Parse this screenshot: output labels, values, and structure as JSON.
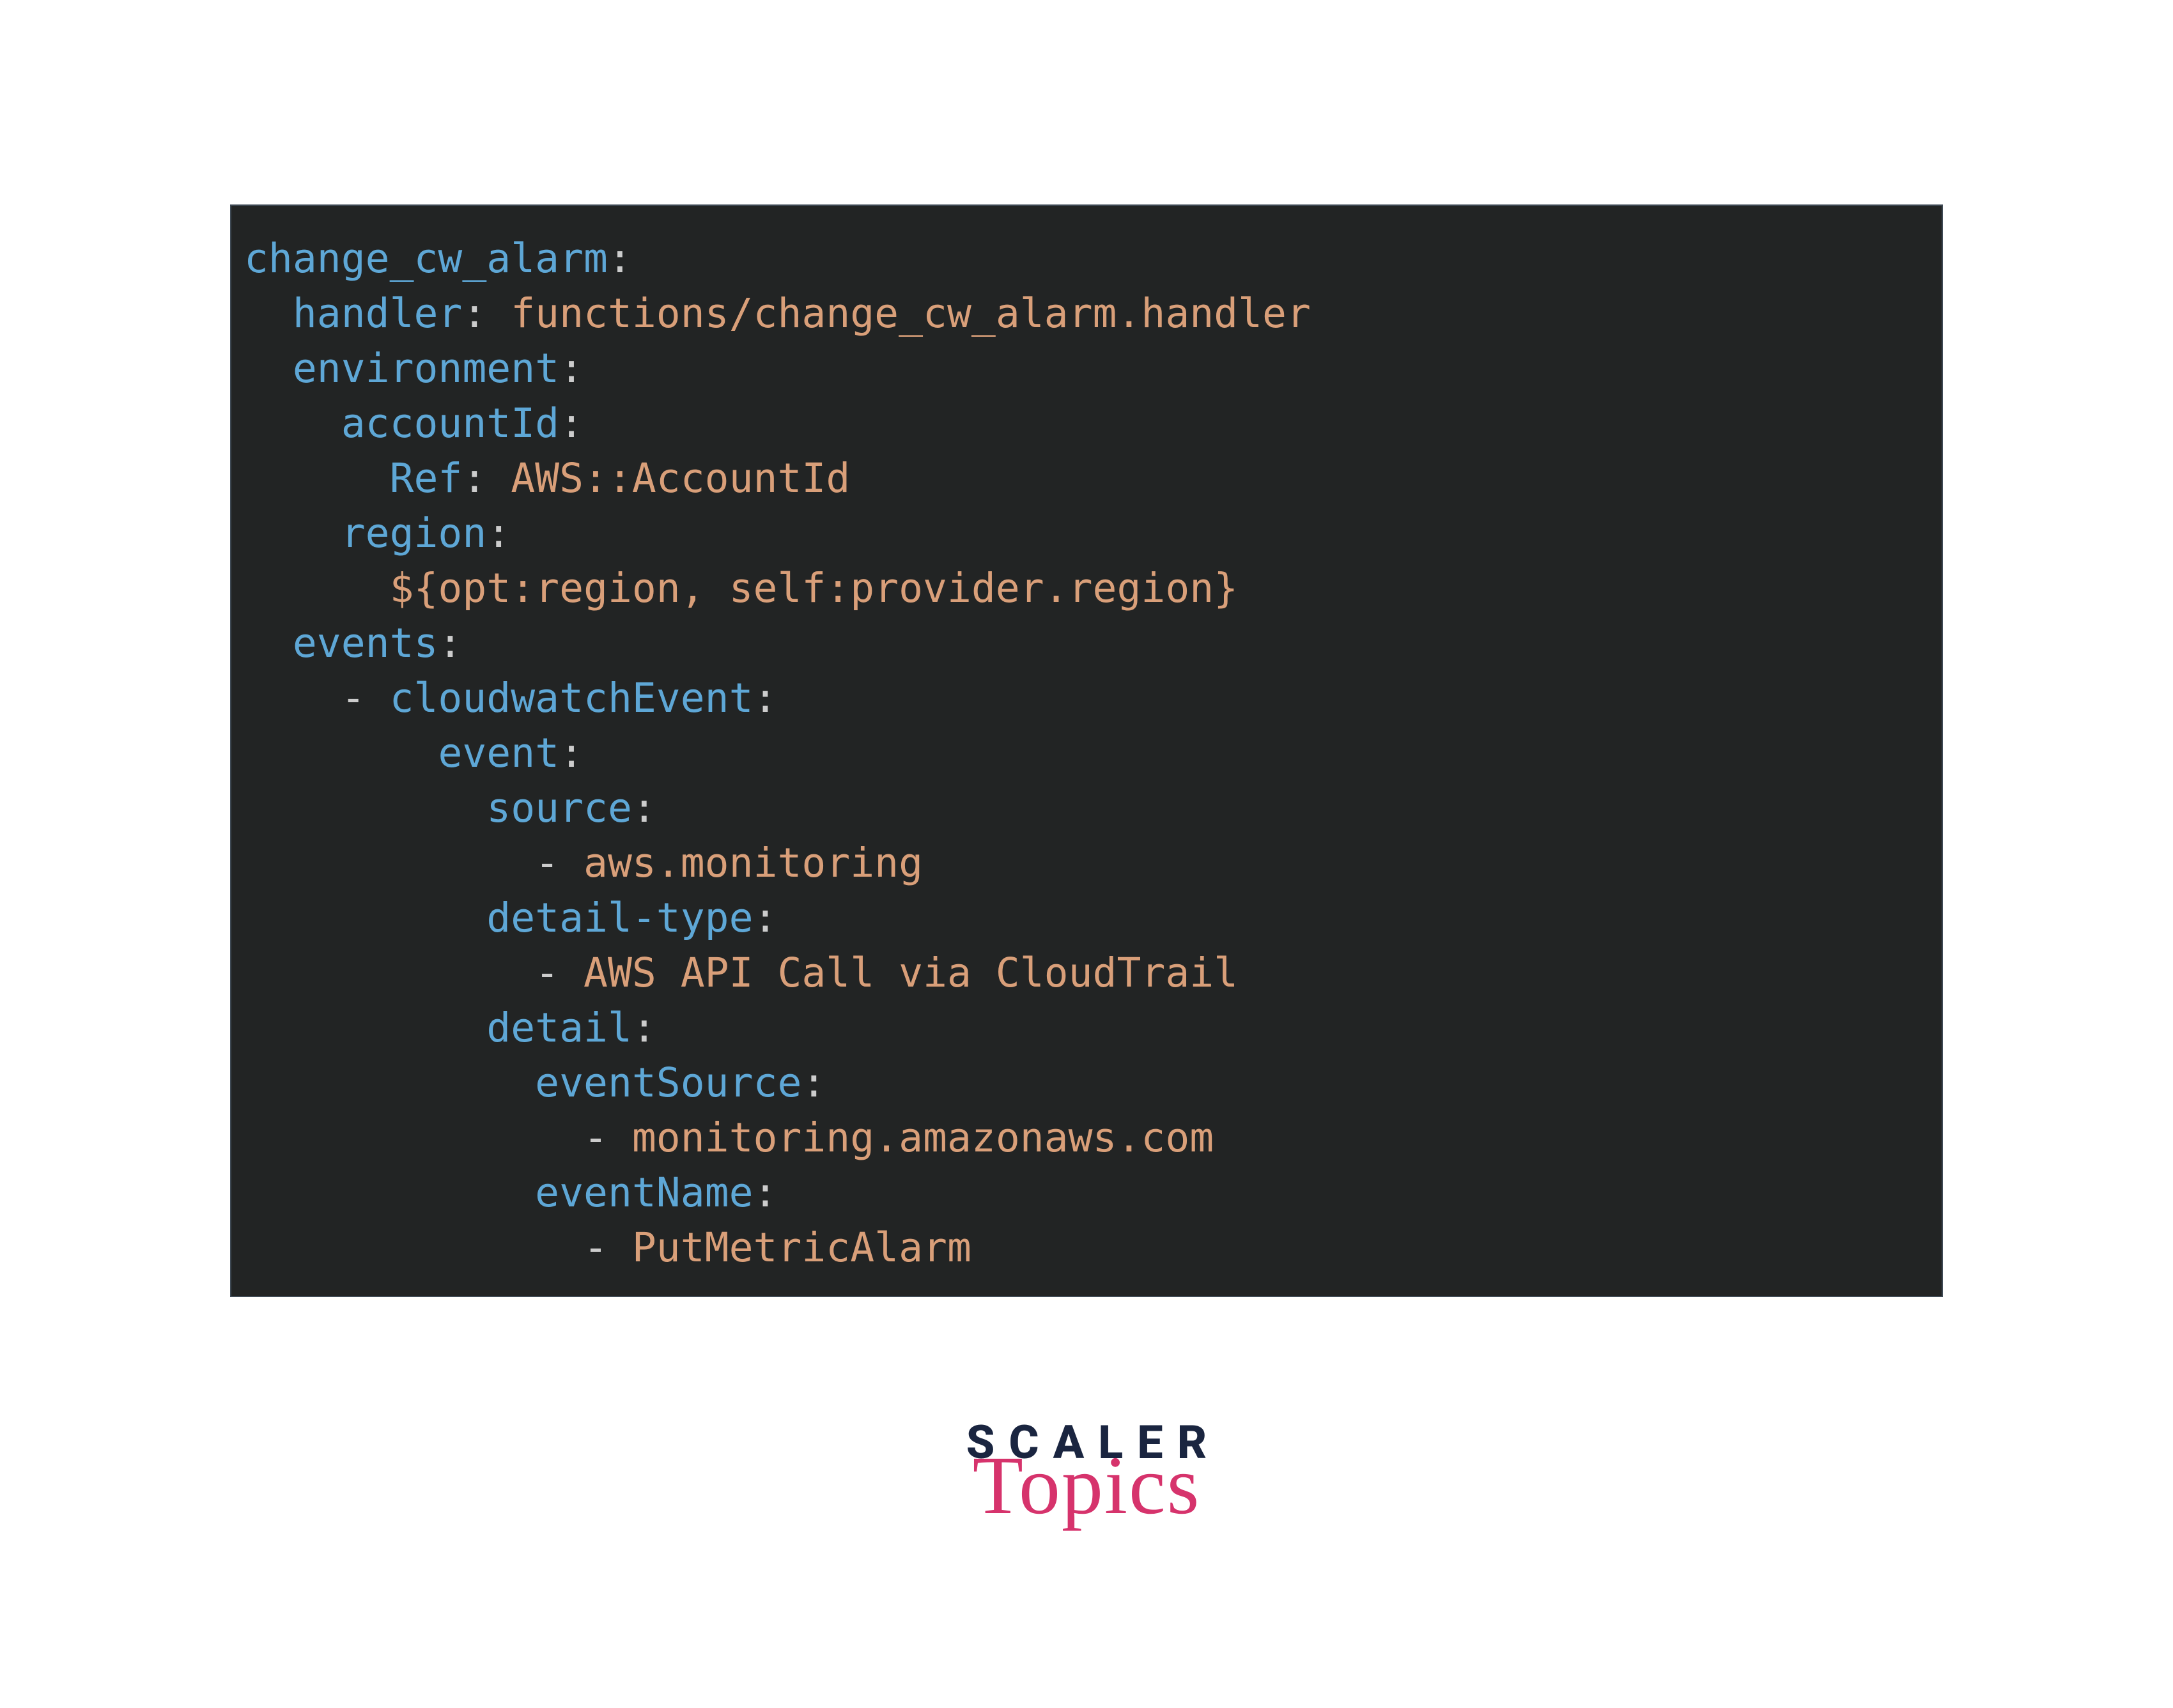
{
  "code": {
    "l1": {
      "k": "change_cw_alarm",
      "c": ":"
    },
    "l2": {
      "k": "handler",
      "c": ": ",
      "v": "functions/change_cw_alarm.handler"
    },
    "l3": {
      "k": "environment",
      "c": ":"
    },
    "l4": {
      "k": "accountId",
      "c": ":"
    },
    "l5": {
      "k": "Ref",
      "c": ": ",
      "v": "AWS::AccountId"
    },
    "l6": {
      "k": "region",
      "c": ":"
    },
    "l7": {
      "v": "${opt:region, self:provider.region}"
    },
    "l8": {
      "k": "events",
      "c": ":"
    },
    "l9": {
      "d": "- ",
      "k": "cloudwatchEvent",
      "c": ":"
    },
    "l10": {
      "k": "event",
      "c": ":"
    },
    "l11": {
      "k": "source",
      "c": ":"
    },
    "l12": {
      "d": "- ",
      "v": "aws.monitoring"
    },
    "l13": {
      "k": "detail-type",
      "c": ":"
    },
    "l14": {
      "d": "- ",
      "v": "AWS API Call via CloudTrail"
    },
    "l15": {
      "k": "detail",
      "c": ":"
    },
    "l16": {
      "k": "eventSource",
      "c": ":"
    },
    "l17": {
      "d": "- ",
      "v": "monitoring.amazonaws.com"
    },
    "l18": {
      "k": "eventName",
      "c": ":"
    },
    "l19": {
      "d": "- ",
      "v": "PutMetricAlarm"
    }
  },
  "logo": {
    "line1": "SCALER",
    "line2": "Topics"
  }
}
